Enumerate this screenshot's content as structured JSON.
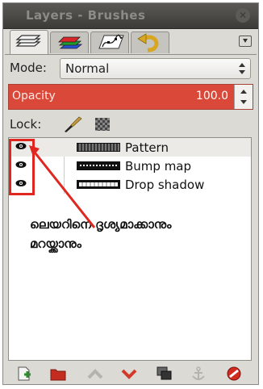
{
  "window": {
    "title": "Layers - Brushes"
  },
  "tabs": [
    {
      "name": "layers-tab",
      "icon": "layers-icon"
    },
    {
      "name": "channels-tab",
      "icon": "channels-icon"
    },
    {
      "name": "paths-tab",
      "icon": "paths-icon"
    },
    {
      "name": "undo-history-tab",
      "icon": "undo-icon"
    }
  ],
  "mode": {
    "label": "Mode:",
    "value": "Normal"
  },
  "opacity": {
    "label": "Opacity",
    "value": "100.0",
    "fraction": 1.0
  },
  "lock": {
    "label": "Lock:"
  },
  "layers": [
    {
      "name": "Pattern",
      "visible": true,
      "selected": true
    },
    {
      "name": "Bump map",
      "visible": true,
      "selected": false
    },
    {
      "name": "Drop shadow",
      "visible": true,
      "selected": false
    }
  ],
  "annotation": {
    "line1": "ലെയറിനെ ദൃശ്യമാക്കാനും",
    "line2": "മറയ്ക്കാനും",
    "color": "#e0271f"
  },
  "bottom_icons": [
    "new-layer-icon",
    "new-layer-group-icon",
    "raise-layer-icon",
    "lower-layer-icon",
    "duplicate-layer-icon",
    "anchor-layer-icon",
    "delete-layer-icon"
  ]
}
